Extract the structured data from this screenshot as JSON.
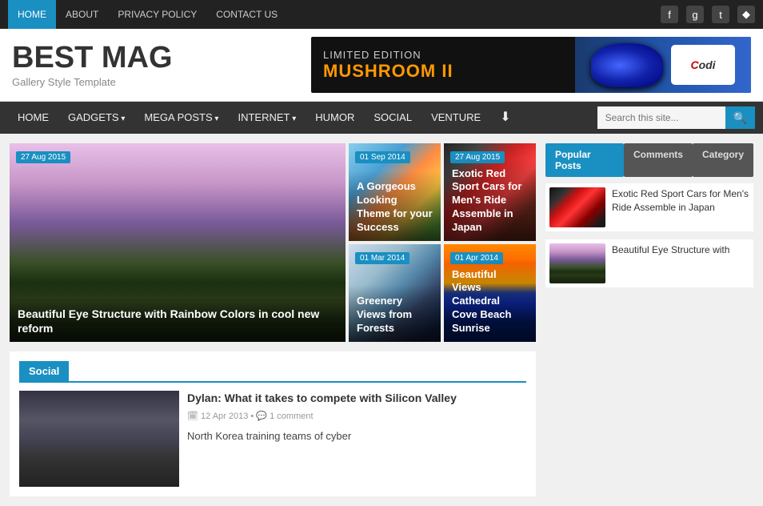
{
  "topNav": {
    "items": [
      {
        "label": "HOME",
        "active": true
      },
      {
        "label": "ABOUT",
        "active": false
      },
      {
        "label": "PRIVACY POLICY",
        "active": false
      },
      {
        "label": "CONTACT US",
        "active": false
      }
    ],
    "socialIcons": [
      "f",
      "g+",
      "t",
      "rss"
    ]
  },
  "header": {
    "siteTitle": "BEST MAG",
    "siteSubtitle": "Gallery Style Template",
    "bannerText1": "LIMITED EDITION",
    "bannerText2": "MUSHROOM II"
  },
  "mainNav": {
    "items": [
      {
        "label": "HOME",
        "dropdown": false
      },
      {
        "label": "GADGETS",
        "dropdown": true
      },
      {
        "label": "MEGA POSTS",
        "dropdown": true
      },
      {
        "label": "INTERNET",
        "dropdown": true
      },
      {
        "label": "HUMOR",
        "dropdown": false
      },
      {
        "label": "SOCIAL",
        "dropdown": false
      },
      {
        "label": "VENTURE",
        "dropdown": false
      }
    ],
    "searchPlaceholder": "Search this site..."
  },
  "gallery": {
    "posts": [
      {
        "id": "large",
        "date": "27 Aug 2015",
        "title": "Beautiful Eye Structure with Rainbow Colors in cool new reform",
        "imgClass": "img-mountain"
      },
      {
        "id": "top-right-1",
        "date": "01 Sep 2014",
        "title": "A Gorgeous Looking Theme for your Success",
        "imgClass": "img-toys"
      },
      {
        "id": "top-right-2",
        "date": "27 Aug 2015",
        "title": "Exotic Red Sport Cars for Men's Ride Assemble in Japan",
        "imgClass": "img-cars"
      },
      {
        "id": "bottom-right-1",
        "date": "01 Mar 2014",
        "title": "Greenery Views from Forests",
        "imgClass": "img-phone"
      },
      {
        "id": "bottom-right-2",
        "date": "01 Apr 2014",
        "title": "Beautiful Views Cathedral Cove Beach Sunrise",
        "imgClass": "img-beach"
      }
    ]
  },
  "social": {
    "sectionLabel": "Social",
    "posts": [
      {
        "title": "Dylan: What it takes to compete with Silicon Valley",
        "date": "12 Apr 2013",
        "comments": "1 comment"
      },
      {
        "title": "North Korea training teams of cyber"
      }
    ]
  },
  "sidebar": {
    "tabs": [
      "Popular Posts",
      "Comments",
      "Category"
    ],
    "activeTab": 0,
    "popularPosts": [
      {
        "title": "Exotic Red Sport Cars for Men's Ride Assemble in Japan",
        "imgClass": "img-cars2"
      },
      {
        "title": "Beautiful Eye Structure with",
        "imgClass": "img-mountain"
      }
    ]
  }
}
